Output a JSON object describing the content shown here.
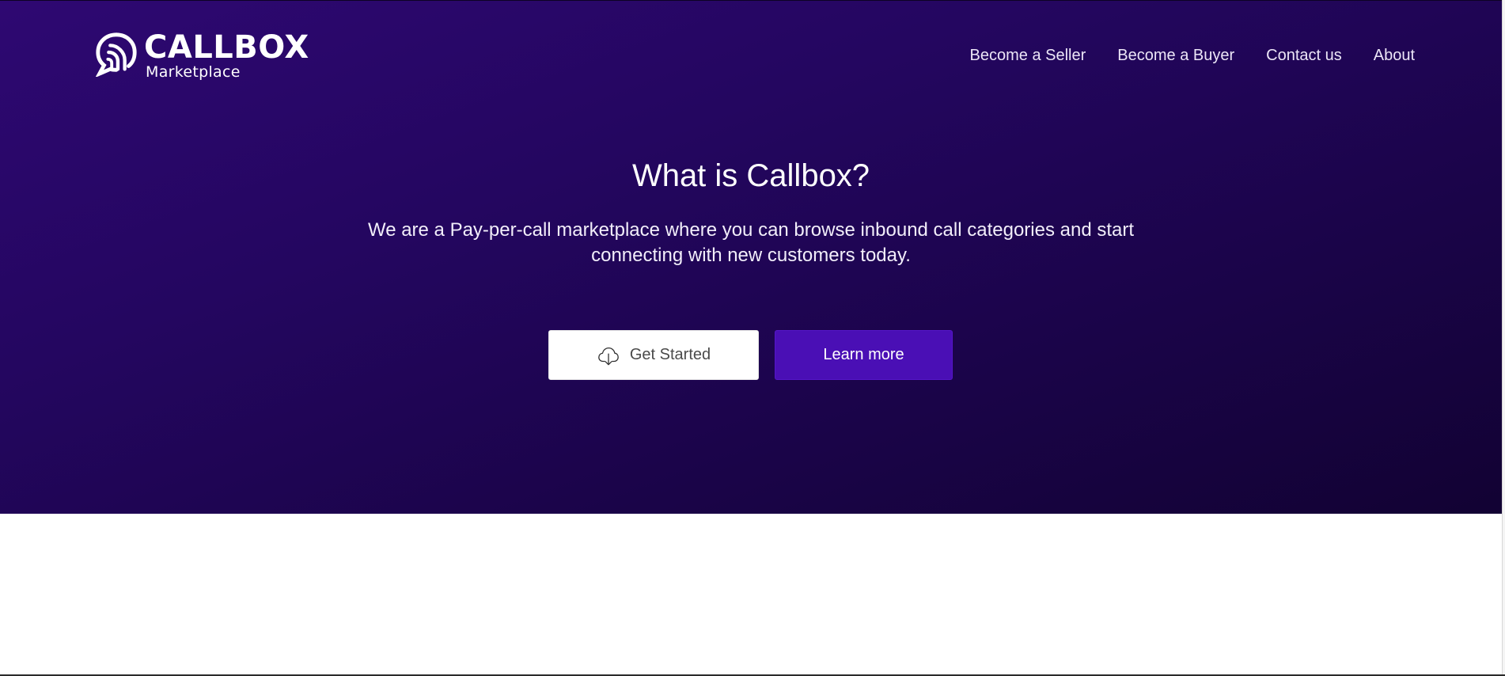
{
  "brand": {
    "name": "CALLBOX",
    "tagline": "Marketplace",
    "logo_icon": "chat-signal-icon"
  },
  "nav": {
    "items": [
      {
        "label": "Become a Seller"
      },
      {
        "label": "Become a Buyer"
      },
      {
        "label": "Contact us"
      },
      {
        "label": "About"
      }
    ]
  },
  "hero": {
    "title": "What is Callbox?",
    "description": "We are a Pay-per-call marketplace where you can browse inbound call categories and start connecting with new customers today.",
    "primary_button": {
      "label": "Get Started",
      "icon": "cloud-download-icon"
    },
    "secondary_button": {
      "label": "Learn more"
    }
  },
  "colors": {
    "hero_gradient_start": "#2e0872",
    "hero_gradient_end": "#120233",
    "accent_button": "#4a0fb5",
    "text_light": "#ffffff"
  }
}
